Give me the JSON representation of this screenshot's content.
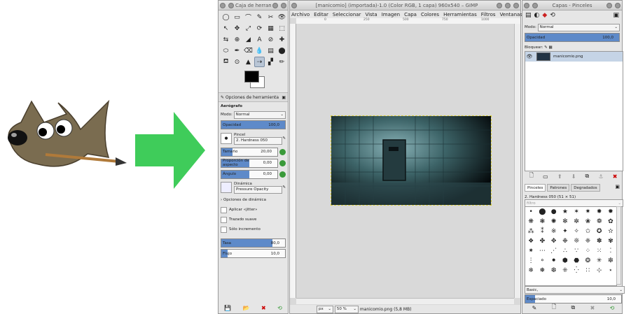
{
  "mascot": {
    "name": "gimp-mascot"
  },
  "arrow": {
    "color": "#3fcc5a"
  },
  "toolbox": {
    "title": "Caja de herram...",
    "tools": [
      "◯",
      "▭",
      "⌒",
      "✎",
      "✂",
      "👁",
      "↖",
      "✥",
      "⤢",
      "⟳",
      "▦",
      "⬚",
      "⇆",
      "⊕",
      "◢",
      "A",
      "⊘",
      "✚",
      "⬭",
      "✒",
      "⌫",
      "💧",
      "▤",
      "⬤",
      "⛾",
      "⊙",
      "▲",
      "⇢",
      "▞",
      "✏"
    ],
    "options_tab": "Opciones de herramienta",
    "tool_name": "Aerógrafo",
    "mode_label": "Modo:",
    "mode_value": "Normal",
    "opacity": {
      "label": "Opacidad",
      "value": "100,0",
      "fraction": 1.0
    },
    "brush_label": "Pincel",
    "brush_value": "2. Hardness 050",
    "size": {
      "label": "Tamaño",
      "value": "20,00",
      "fraction": 0.2
    },
    "aspect": {
      "label": "Proporción de aspecto",
      "value": "0,00",
      "fraction": 0.5
    },
    "angle": {
      "label": "Ángulo",
      "value": "0,00",
      "fraction": 0.5
    },
    "dynamics_label": "Dinámica",
    "dynamics_value": "Pressure Opacity",
    "dynamics_options": "Opciones de dinámica",
    "jitter": "Aplicar «jitter»",
    "smooth": "Trazado suave",
    "incremental": "Sólo incremento",
    "rate": {
      "label": "Tasa",
      "value": "80,0",
      "fraction": 0.8
    },
    "flow": {
      "label": "Flujo",
      "value": "10,0",
      "fraction": 0.1
    }
  },
  "image_window": {
    "title": "[manicomio] (importada)-1.0 (Color RGB, 1 capa) 960x540 – GIMP",
    "menu": [
      "Archivo",
      "Editar",
      "Seleccionar",
      "Vista",
      "Imagen",
      "Capa",
      "Colores",
      "Herramientas",
      "Filtros",
      "Ventanas",
      "Ayuda"
    ],
    "ruler_marks": [
      "0",
      "250",
      "500",
      "750",
      "1000"
    ],
    "unit": "px",
    "zoom": "50 %",
    "status": "manicomio.png (5,8 MB)"
  },
  "dock": {
    "title": "Capas - Pinceles",
    "mode_label": "Modo:",
    "mode_value": "Normal",
    "opacity": {
      "label": "Opacidad",
      "value": "100,0",
      "fraction": 1.0
    },
    "lock_label": "Bloquear:",
    "layer_name": "manicomio.png",
    "tabs": [
      "Pinceles",
      "Patrones",
      "Degradados"
    ],
    "brush_name": "2. Hardness 050 (51 × 51)",
    "filter_placeholder": "filtro",
    "brush_set": "Basic,",
    "spacing": {
      "label": "Espaciado",
      "value": "10,0",
      "fraction": 0.1
    },
    "brushes": [
      "•",
      "⬤",
      "●",
      "★",
      "✶",
      "✷",
      "✸",
      "✹",
      "❋",
      "❃",
      "✺",
      "✻",
      "✼",
      "❀",
      "❁",
      "✿",
      "⁂",
      "⁑",
      "※",
      "✦",
      "✧",
      "✩",
      "✪",
      "✫",
      "❖",
      "✤",
      "✥",
      "❉",
      "❊",
      "❈",
      "✽",
      "✾",
      "⁕",
      "⋯",
      "⋰",
      "∴",
      "∵",
      "⁘",
      "⁙",
      "⁚",
      "⋮",
      "⚬",
      "⚫",
      "⬢",
      "⬣",
      "❂",
      "✳",
      "❇",
      "❄",
      "❅",
      "❆",
      "⁜",
      "⁛",
      "∷",
      "⊹",
      "⋆"
    ]
  }
}
